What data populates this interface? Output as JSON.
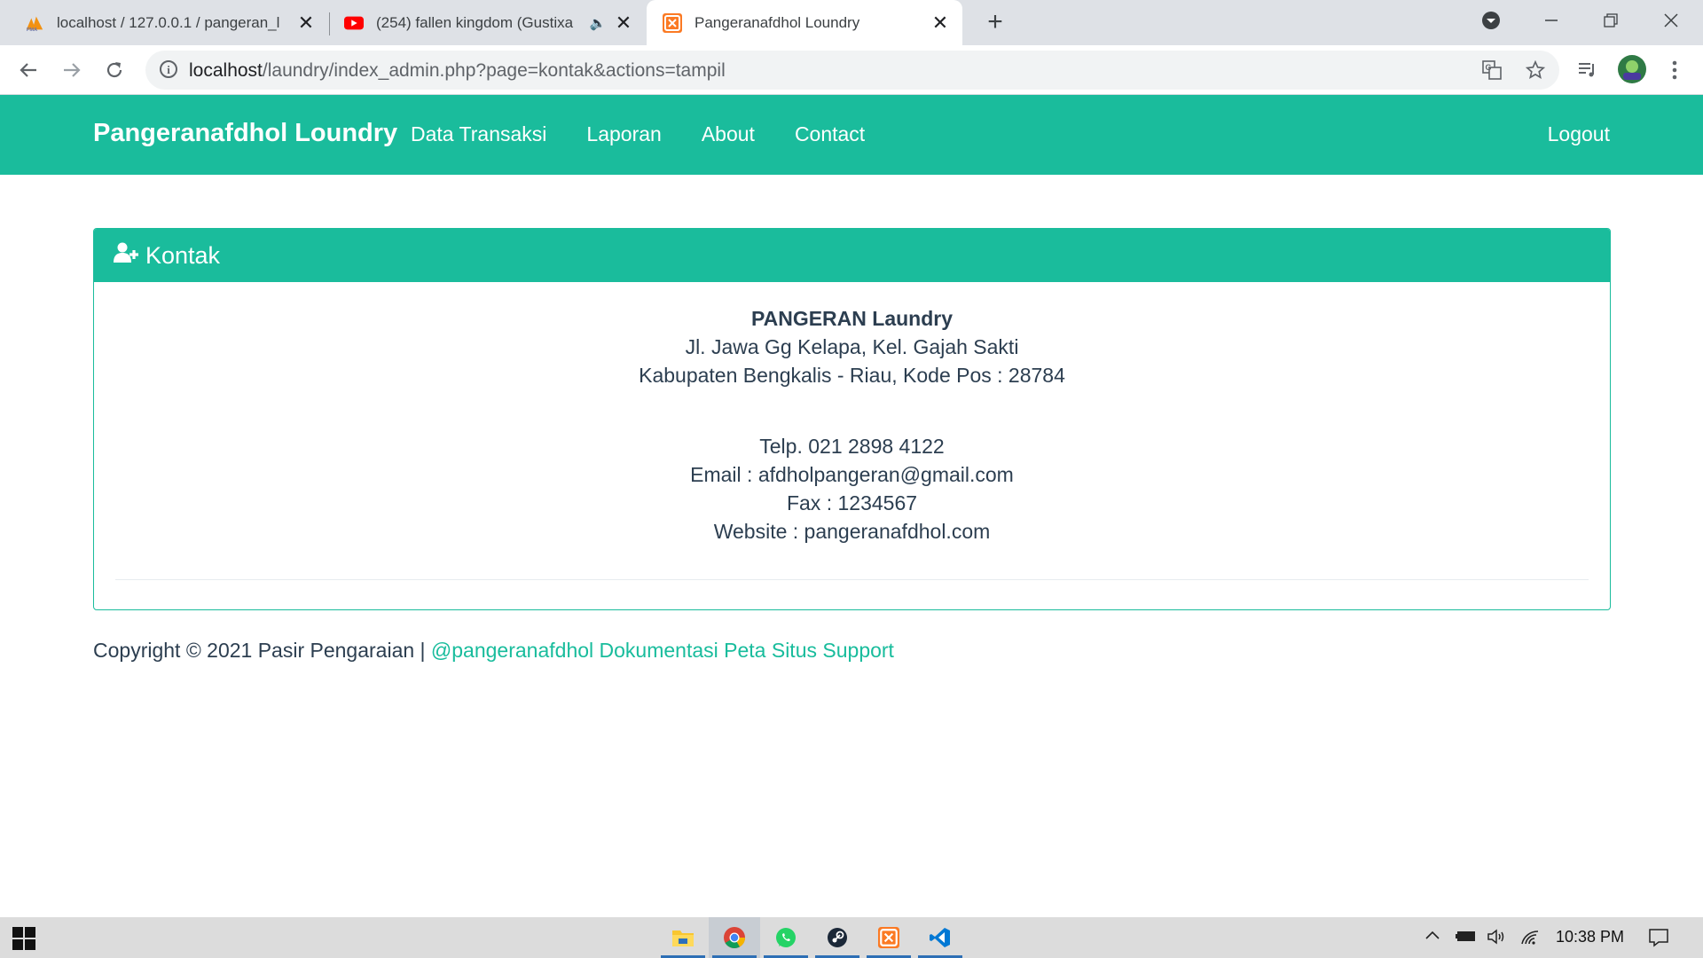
{
  "browser": {
    "tabs": [
      {
        "title": "localhost / 127.0.0.1 / pangeran_l",
        "favicon": "phpmyadmin-icon",
        "active": false
      },
      {
        "title": "(254) fallen kingdom (Gustixa",
        "favicon": "youtube-icon",
        "active": false,
        "audio": true
      },
      {
        "title": "Pangeranafdhol Loundry",
        "favicon": "xampp-icon",
        "active": true
      }
    ],
    "new_tab_label": "+",
    "url_host": "localhost",
    "url_path": "/laundry/index_admin.php?page=kontak&actions=tampil"
  },
  "navbar": {
    "brand": "Pangeranafdhol Loundry",
    "links": [
      "Data Transaksi",
      "Laporan",
      "About",
      "Contact"
    ],
    "logout": "Logout"
  },
  "panel": {
    "heading": "Kontak",
    "company": "PANGERAN Laundry",
    "address_line1": "Jl. Jawa Gg Kelapa, Kel. Gajah Sakti",
    "address_line2": "Kabupaten Bengkalis - Riau, Kode Pos : 28784",
    "phone": "Telp. 021 2898 4122",
    "email": "Email : afdholpangeran@gmail.com",
    "fax": "Fax : 1234567",
    "website": "Website : pangeranafdhol.com"
  },
  "footer": {
    "copyright": "Copyright © 2021 Pasir Pengaraian | ",
    "links": [
      "@pangeranafdhol",
      "Dokumentasi",
      "Peta Situs",
      "Support"
    ]
  },
  "taskbar": {
    "apps": [
      "file-explorer-icon",
      "chrome-icon",
      "whatsapp-icon",
      "steam-icon",
      "xampp-icon",
      "vscode-icon"
    ],
    "clock": "10:38 PM"
  },
  "colors": {
    "primary": "#1abc9c",
    "text": "#2c3e50",
    "link": "#18bc9c"
  }
}
